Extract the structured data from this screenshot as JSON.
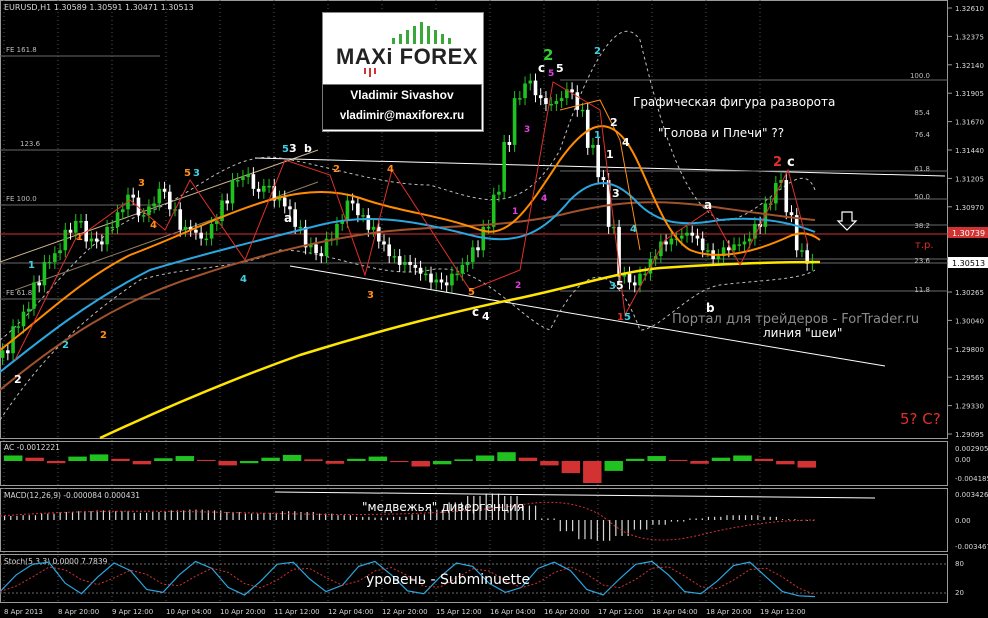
{
  "header": {
    "symbol_label": "EURUSD,H1  1.30589 1.30591 1.30471 1.30513"
  },
  "logo": {
    "brand_maxi": "MAXi",
    "brand_forex": "FOREX",
    "author": "Vladimir Sivashov",
    "email": "vladimir@maxiforex.ru"
  },
  "annotations": {
    "pattern_title": "Графическая фигура разворота",
    "pattern_name": "\"Голова и Плечи\" ??",
    "neckline": "линия \"шеи\"",
    "watermark": "Портал для трейдеров - ForTrader.ru",
    "tp": "т.р.",
    "five_c": "5? C?",
    "divergence": "\"медвежья\" дивергенция",
    "level": "уровень - Subminuette"
  },
  "fib_labels": [
    "FE 161.8",
    "123.6",
    "FE 100.0",
    "FE 61.8"
  ],
  "fib_right_labels": [
    "100.0",
    "85.4",
    "76.4",
    "61.8",
    "50.0",
    "38.2",
    "23.6",
    "11.8"
  ],
  "colors": {
    "background": "#000000",
    "candle_up": "#1fc21f",
    "candle_down": "#ffffff",
    "ma_orange": "#ff8c00",
    "ma_blue": "#2aa7e0",
    "ma_brown": "#a0522d",
    "ma_yellow": "#ffe600",
    "neck_line": "#ffffff",
    "resistance_red": "#d23232",
    "wave_red": "#e0302a",
    "wave_green": "#33cc33",
    "wave_cyan": "#3fd0e0",
    "wave_magenta": "#e040e0",
    "wave_orange": "#ff8c1a"
  },
  "chart_data": [
    {
      "type": "line",
      "title": "EURUSD,H1",
      "y_ticks": [
        "1.32610",
        "1.32375",
        "1.32140",
        "1.31905",
        "1.31670",
        "1.31440",
        "1.31205",
        "1.30970",
        "1.30740",
        "1.30513",
        "1.30265",
        "1.30040",
        "1.29800",
        "1.29565",
        "1.29330",
        "1.29095"
      ],
      "x_ticks": [
        "8 Apr 2013",
        "8 Apr 20:00",
        "9 Apr 12:00",
        "10 Apr 04:00",
        "10 Apr 20:00",
        "11 Apr 12:00",
        "12 Apr 04:00",
        "12 Apr 20:00",
        "15 Apr 12:00",
        "16 Apr 04:00",
        "16 Apr 20:00",
        "17 Apr 12:00",
        "18 Apr 04:00",
        "18 Apr 20:00",
        "19 Apr 12:00"
      ],
      "ylim": [
        1.2903,
        1.3267
      ],
      "price_tags": [
        {
          "label": "1.30739",
          "value": 1.30739,
          "color": "#d23232"
        },
        {
          "label": "1.30513",
          "value": 1.30513,
          "color": "#ffffff"
        }
      ],
      "close_series": [
        1.2972,
        1.2995,
        1.301,
        1.303,
        1.305,
        1.306,
        1.3075,
        1.3085,
        1.307,
        1.3065,
        1.308,
        1.3095,
        1.3105,
        1.309,
        1.31,
        1.311,
        1.3095,
        1.308,
        1.3075,
        1.307,
        1.3085,
        1.31,
        1.312,
        1.3125,
        1.311,
        1.3115,
        1.3105,
        1.3095,
        1.308,
        1.3065,
        1.3055,
        1.307,
        1.3085,
        1.31,
        1.309,
        1.308,
        1.3065,
        1.3055,
        1.305,
        1.3045,
        1.304,
        1.3035,
        1.303,
        1.304,
        1.305,
        1.306,
        1.308,
        1.311,
        1.315,
        1.319,
        1.3205,
        1.319,
        1.3185,
        1.319,
        1.3195,
        1.318,
        1.315,
        1.312,
        1.308,
        1.304,
        1.303,
        1.304,
        1.3055,
        1.3065,
        1.307,
        1.3075,
        1.307,
        1.306,
        1.3055,
        1.306,
        1.3065,
        1.307,
        1.308,
        1.31,
        1.312,
        1.309,
        1.306,
        1.3051
      ]
    },
    {
      "type": "bar",
      "title": "AC -0.0012221",
      "y_ticks": [
        "0.002905",
        "0.00",
        "-0.004185"
      ],
      "ylim": [
        -0.0048,
        0.0032
      ],
      "values": [
        0.001,
        0.0006,
        -0.0004,
        0.0008,
        0.0012,
        0.0004,
        -0.0006,
        0.0005,
        0.0009,
        0.0002,
        -0.0008,
        -0.0004,
        0.0006,
        0.0011,
        0.0003,
        -0.0005,
        0.0004,
        0.0008,
        -0.0002,
        -0.001,
        -0.0006,
        0.0003,
        0.001,
        0.0016,
        0.0006,
        -0.0008,
        -0.0022,
        -0.004,
        -0.0018,
        0.0004,
        0.0009,
        0.0002,
        -0.0005,
        0.0006,
        0.001,
        0.0004,
        -0.0006,
        -0.0012
      ]
    },
    {
      "type": "bar",
      "title": "MACD(12,26,9) -0.000084 0.000431",
      "y_ticks": [
        "0.003426",
        "0.00",
        "-0.003467"
      ],
      "ylim": [
        -0.004,
        0.004
      ],
      "values": [
        0.0005,
        0.0006,
        0.0008,
        0.001,
        0.0011,
        0.0012,
        0.0011,
        0.0009,
        0.001,
        0.0012,
        0.0013,
        0.0012,
        0.001,
        0.0008,
        0.0009,
        0.0011,
        0.001,
        0.0008,
        0.0006,
        0.0004,
        0.0003,
        0.0004,
        0.0007,
        0.0013,
        0.0022,
        0.003,
        0.0033,
        0.003,
        0.0018,
        0.0002,
        -0.0014,
        -0.0024,
        -0.0026,
        -0.002,
        -0.0012,
        -0.0006,
        -0.0002,
        0.0002,
        0.0004,
        0.0006,
        0.0006,
        0.0004,
        0.0001,
        -0.0001
      ]
    },
    {
      "type": "line",
      "title": "Stoch(5,3,3) 0.0000 7.7839",
      "y_ticks": [
        "80",
        "20"
      ],
      "ylim": [
        0,
        100
      ],
      "values": [
        20,
        60,
        85,
        90,
        40,
        15,
        55,
        88,
        70,
        25,
        18,
        60,
        92,
        75,
        30,
        12,
        45,
        85,
        90,
        50,
        20,
        35,
        80,
        92,
        60,
        22,
        15,
        55,
        88,
        80,
        40,
        18,
        30,
        75,
        90,
        70,
        25,
        12,
        50,
        85,
        92,
        60,
        20,
        15,
        45,
        82,
        90,
        55,
        20,
        10,
        8
      ]
    }
  ]
}
